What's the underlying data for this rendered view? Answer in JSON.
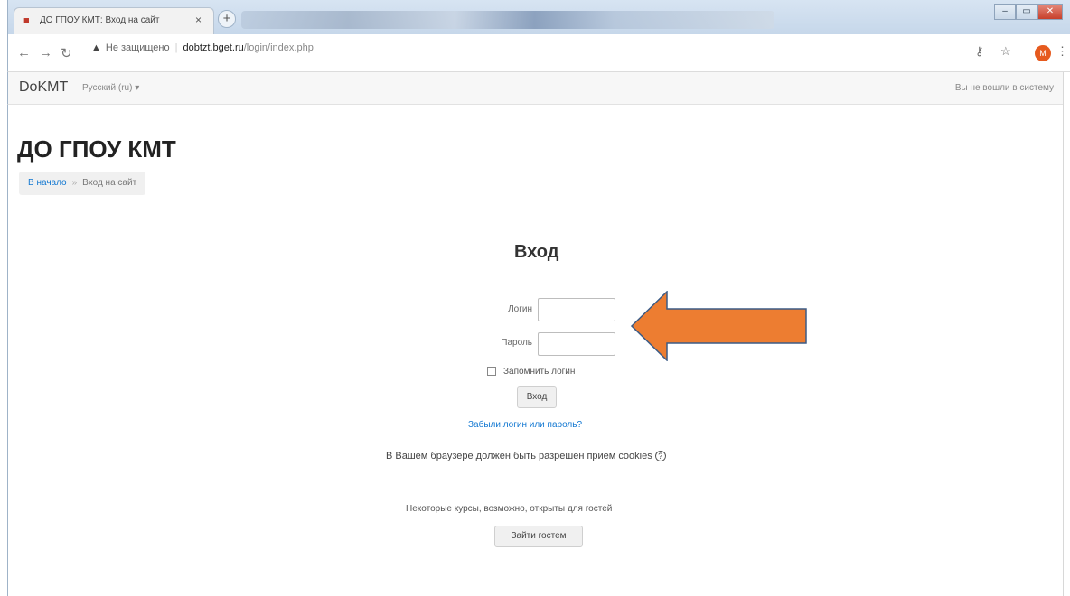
{
  "browser": {
    "tab_title": "ДО ГПОУ КМТ: Вход на сайт",
    "tab_close": "×",
    "new_tab": "+",
    "warning_label": "Не защищено",
    "url_host": "dobtzt.bget.ru",
    "url_path": "/login/index.php",
    "avatar_letter": "М"
  },
  "navbar": {
    "brand": "DoKMT",
    "language": "Русский (ru) ▾",
    "status": "Вы не вошли в систему"
  },
  "page": {
    "title": "ДО ГПОУ КМТ",
    "breadcrumb_home": "В начало",
    "breadcrumb_sep": "»",
    "breadcrumb_current": "Вход на сайт"
  },
  "login": {
    "heading": "Вход",
    "username_label": "Логин",
    "password_label": "Пароль",
    "remember_label": "Запомнить логин",
    "submit_label": "Вход",
    "forgot_link": "Забыли логин или пароль?",
    "cookies_notice": "В Вашем браузере должен быть разрешен прием cookies",
    "help_icon": "?",
    "guest_notice": "Некоторые курсы, возможно, открыты для гостей",
    "guest_button": "Зайти гостем"
  },
  "annotation": {
    "arrow_color": "#ed7d31",
    "arrow_border": "#3b5b86"
  }
}
